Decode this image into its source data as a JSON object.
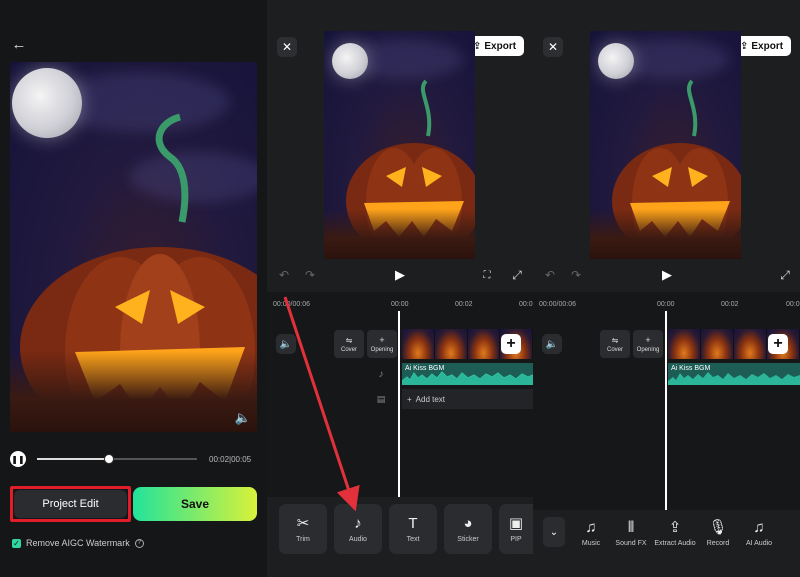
{
  "left": {
    "back_icon": "back-arrow-icon",
    "time_current": "00:02",
    "time_total": "00:05",
    "progress": 0.45,
    "project_edit_label": "Project Edit",
    "save_label": "Save",
    "watermark_label": "Remove AIGC Watermark",
    "watermark_checked": true,
    "highlight_color": "#e11d2a",
    "save_gradient": [
      "#22e39a",
      "#d8f23a"
    ]
  },
  "middle": {
    "close_label": "✕",
    "export_label": "Export",
    "ruler_start": "00:00/00:06",
    "ruler_ticks": [
      "00:00",
      "00:02",
      "00:0"
    ],
    "cover_label": "Cover",
    "opening_label": "Opening",
    "audio_track_label": "Ai Kiss BGM",
    "add_text_label": "Add text",
    "tools": [
      {
        "label": "Trim",
        "icon": "✂"
      },
      {
        "label": "Audio",
        "icon": "♪"
      },
      {
        "label": "Text",
        "icon": "T"
      },
      {
        "label": "Sticker",
        "icon": "◕"
      },
      {
        "label": "PIP",
        "icon": "▣"
      }
    ]
  },
  "right": {
    "close_label": "✕",
    "export_label": "Export",
    "ruler_start": "00:00/00:06",
    "ruler_ticks": [
      "00:00",
      "00:02",
      "00:0"
    ],
    "cover_label": "Cover",
    "opening_label": "Opening",
    "audio_track_label": "Ai Kiss BGM",
    "tools": [
      {
        "label": "Music",
        "icon": "♫"
      },
      {
        "label": "Sound FX",
        "icon": "⦀"
      },
      {
        "label": "Extract Audio",
        "icon": "⇪"
      },
      {
        "label": "Record",
        "icon": "🎙"
      },
      {
        "label": "AI Audio",
        "icon": "♫"
      }
    ]
  },
  "annotation_color": "#e2313a"
}
